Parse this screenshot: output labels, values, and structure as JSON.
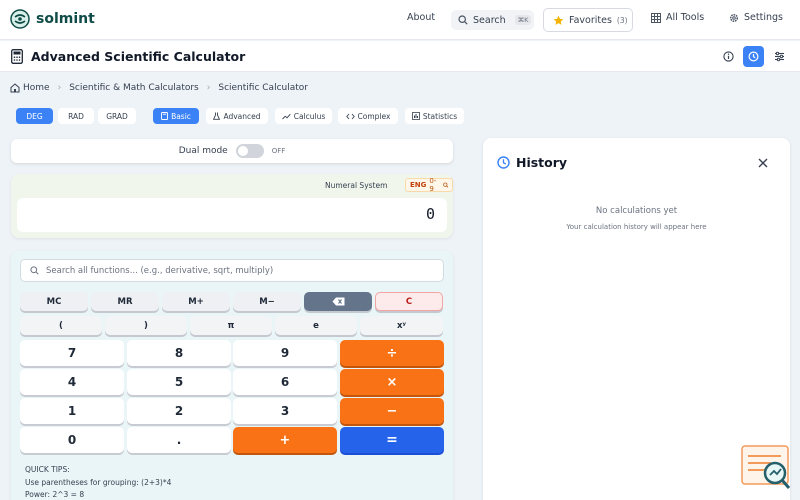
{
  "brand": {
    "name": "solmint"
  },
  "nav": {
    "about": "About",
    "search": "Search",
    "search_shortcut": "⌘K",
    "favorites": "Favorites",
    "favorites_count": "(3)",
    "all_tools": "All Tools",
    "settings": "Settings"
  },
  "page": {
    "title": "Advanced Scientific Calculator"
  },
  "breadcrumb": [
    "Home",
    "Scientific & Math Calculators",
    "Scientific Calculator"
  ],
  "angle_modes": [
    {
      "label": "DEG",
      "active": true
    },
    {
      "label": "RAD",
      "active": false
    },
    {
      "label": "GRAD",
      "active": false
    }
  ],
  "calc_tabs": [
    {
      "label": "Basic",
      "icon": "calculator-icon",
      "active": true
    },
    {
      "label": "Advanced",
      "icon": "flask-icon",
      "active": false
    },
    {
      "label": "Calculus",
      "icon": "trend-icon",
      "active": false
    },
    {
      "label": "Complex",
      "icon": "code-icon",
      "active": false
    },
    {
      "label": "Statistics",
      "icon": "chart-icon",
      "active": false
    }
  ],
  "dual_mode": {
    "label": "Dual mode",
    "state": "OFF"
  },
  "display": {
    "numeral_label": "Numeral System",
    "numeral_badge": "ENG",
    "numeral_range": "0-9",
    "value": "0"
  },
  "function_search": {
    "placeholder": "Search all functions... (e.g., derivative, sqrt, multiply)"
  },
  "memory_keys": [
    "MC",
    "MR",
    "M+",
    "M−",
    "",
    "C"
  ],
  "function_keys": [
    "(",
    ")",
    "π",
    "e",
    "xʸ"
  ],
  "number_keys": [
    [
      "7",
      "8",
      "9",
      "÷"
    ],
    [
      "4",
      "5",
      "6",
      "×"
    ],
    [
      "1",
      "2",
      "3",
      "−"
    ],
    [
      "0",
      ".",
      "+",
      "="
    ]
  ],
  "tips": {
    "heading": "QUICK TIPS:",
    "items": [
      "Use parentheses for grouping: (2+3)*4",
      "Power: 2^3 = 8"
    ]
  },
  "history": {
    "title": "History",
    "empty": "No calculations yet",
    "subtitle": "Your calculation history will appear here"
  },
  "colors": {
    "accent": "#3b82f6",
    "operator": "#f97316",
    "equals": "#2563eb",
    "brand": "#0f4c47"
  }
}
